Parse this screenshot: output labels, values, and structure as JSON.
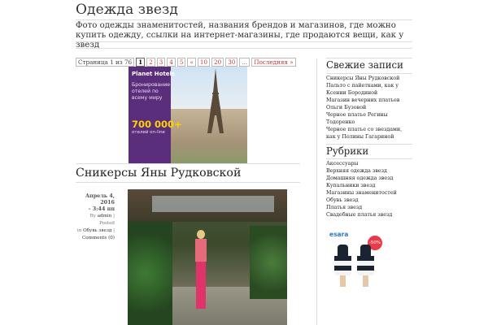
{
  "site": {
    "title": "Одежда звезд",
    "description": "Фото одежды знаменитостей, названия брендов и магазинов, где можно купить одежду, ссылки на интернет-магазины, где продаются вещи, как у звезд"
  },
  "pagination": {
    "label": "Страница 1 из 76",
    "current": "1",
    "pages": [
      "2",
      "3",
      "4",
      "5"
    ],
    "prev_symbol": "«",
    "more_pages": [
      "10",
      "20",
      "30"
    ],
    "dots": "...",
    "last": "Последняя »"
  },
  "ad": {
    "logo": "Planet Hotels",
    "text": "Бронирование отелей по всему миру",
    "number": "700 000+",
    "subtext": "отелей on-line"
  },
  "post": {
    "title": "Сникерсы Яны Рудковской",
    "date": "Апрель 4, 2016",
    "time": "- 3:44 пп",
    "by_label": "By",
    "author": "admin",
    "posted_label": "| Posted",
    "in_label": "in",
    "category": "Обувь звезд",
    "sep": "|",
    "comments": "Comments (0)"
  },
  "sidebar": {
    "recent_title": "Свежие записи",
    "recent": [
      "Сникерсы Яны Рудковской",
      "Пальто с пайетками, как у Ксении Бородиной",
      "Магазин вечерних платьев Ольги Бузовой",
      "Черное платье Регины Тодоренко",
      "Черное платье со звездами, как у Полины Гагариной"
    ],
    "categories_title": "Рубрики",
    "categories": [
      "Аксессуары",
      "Верхняя одежда звезд",
      "Домашняя одежда звезд",
      "Купальники звезд",
      "Магазины знаменитостей",
      "Обувь звезд",
      "Платья звезд",
      "Свадебные платья звезд"
    ],
    "ad_logo": "esara",
    "ad_badge": "-50%"
  }
}
